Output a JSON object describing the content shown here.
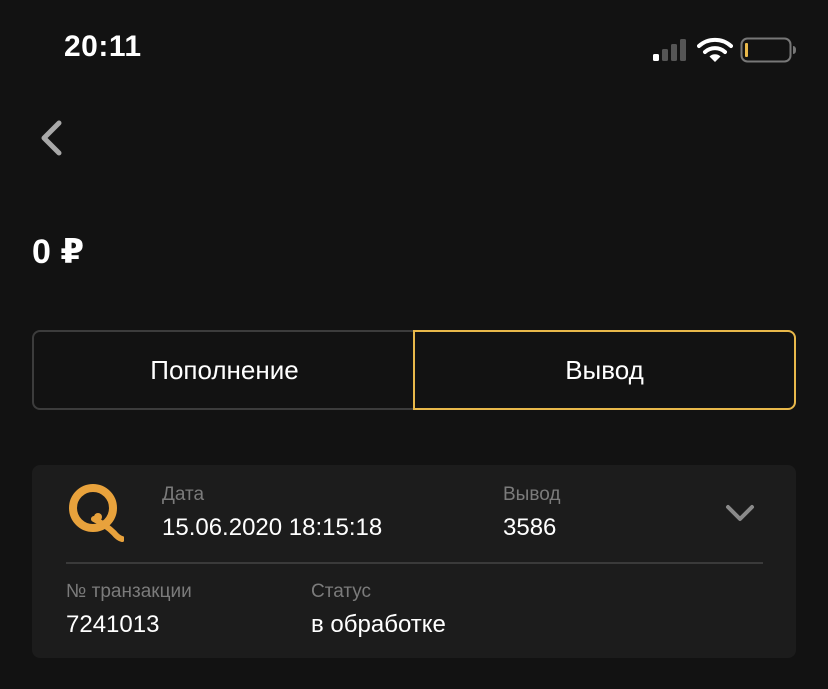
{
  "status_bar": {
    "time": "20:11"
  },
  "balance": {
    "text": "0 ₽"
  },
  "tabs": [
    {
      "label": "Пополнение",
      "selected": false
    },
    {
      "label": "Вывод",
      "selected": true
    }
  ],
  "transaction": {
    "method_icon": "qiwi-logo-icon",
    "date_label": "Дата",
    "date_value": "15.06.2020 18:15:18",
    "type_label": "Вывод",
    "amount_value": "3586",
    "id_label": "№ транзакции",
    "id_value": "7241013",
    "status_label": "Статус",
    "status_value": "в обработке"
  },
  "colors": {
    "background": "#121212",
    "card": "#1c1c1c",
    "accent": "#e8b84a",
    "muted_text": "#7b7b7b",
    "tab_border": "#3c3c3c"
  }
}
